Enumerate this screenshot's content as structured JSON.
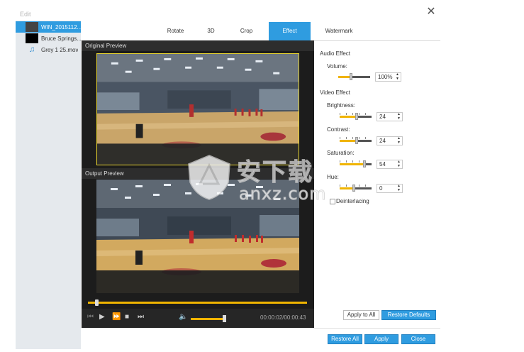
{
  "dialog": {
    "title": "Edit",
    "close_glyph": "✕"
  },
  "files": [
    {
      "name": "WIN_2015112...",
      "selected": true,
      "icon": "video-thumbnail"
    },
    {
      "name": "Bruce Springs...",
      "selected": false,
      "icon": "video-thumbnail"
    },
    {
      "name": "Grey 1 25.mov",
      "selected": false,
      "icon": "music-note-icon"
    }
  ],
  "tabs": [
    "Rotate",
    "3D",
    "Crop",
    "Effect",
    "Watermark"
  ],
  "active_tab": "Effect",
  "preview": {
    "original_label": "Original Preview",
    "output_label": "Output Preview",
    "seek_position": 0.03,
    "volume_level": 0.95,
    "timecode": "00:00:02/00:00:43"
  },
  "audio_effect": {
    "title": "Audio Effect",
    "volume_label": "Volume:",
    "volume_value": "100%",
    "volume_slider_fraction": 0.4
  },
  "video_effect": {
    "title": "Video Effect",
    "brightness_label": "Brightness:",
    "brightness_value": "24",
    "contrast_label": "Contrast:",
    "contrast_value": "24",
    "saturation_label": "Saturation:",
    "saturation_value": "54",
    "hue_label": "Hue:",
    "hue_value": "0",
    "deinterlacing_label": "Deinterlacing",
    "deinterlacing_checked": false
  },
  "buttons": {
    "apply_to_all": "Apply to All",
    "restore_defaults": "Restore Defaults",
    "restore_all": "Restore All",
    "apply": "Apply",
    "close": "Close"
  },
  "watermark": {
    "chinese": "安下载",
    "latin": "anxz.com"
  },
  "colors": {
    "accent": "#2f9ce0",
    "slider_fill": "#f0b400",
    "preview_bg": "#1c1c1c"
  }
}
